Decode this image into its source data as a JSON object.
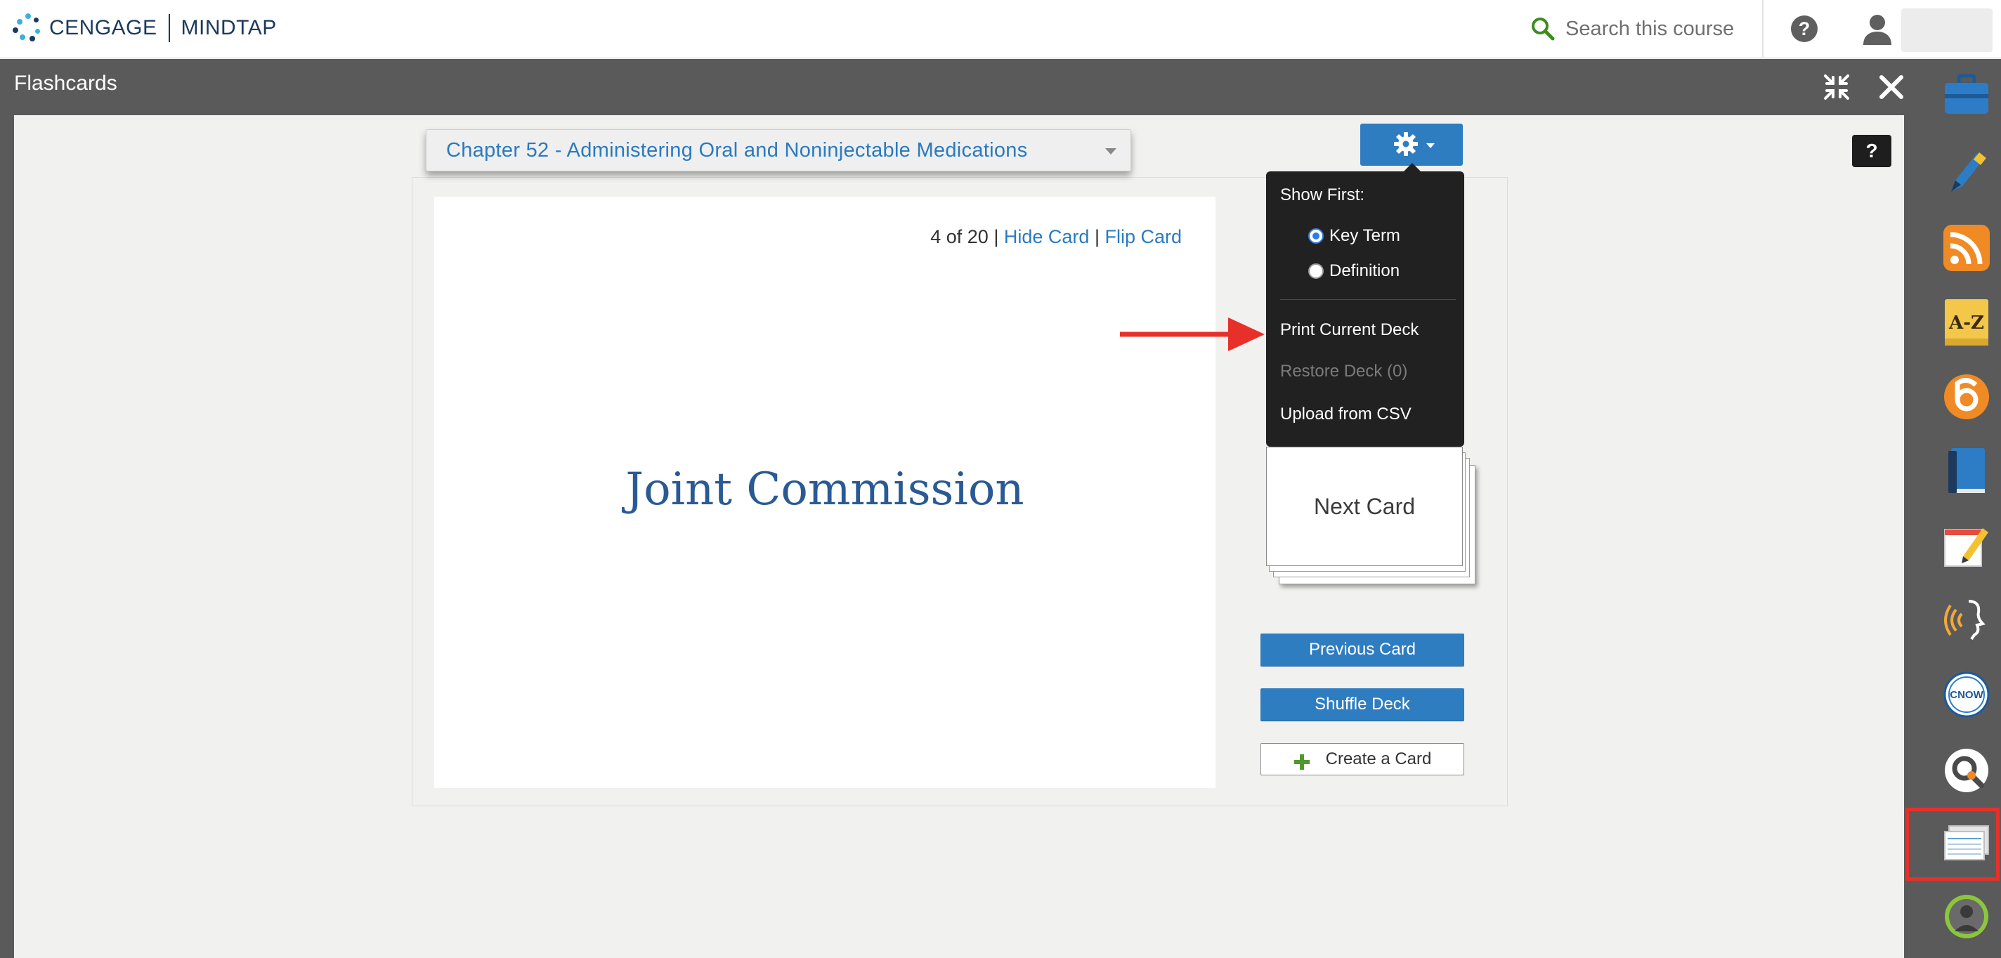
{
  "topbar": {
    "brand_left": "CENGAGE",
    "brand_right": "MINDTAP",
    "search_placeholder": "Search this course",
    "help_label": "?"
  },
  "panel": {
    "title": "Flashcards",
    "help_label": "?"
  },
  "deck": {
    "selected": "Chapter 52 - Administering Oral and Noninjectable Medications"
  },
  "card": {
    "position": "4 of 20",
    "separator": "|",
    "hide_label": "Hide Card",
    "flip_label": "Flip Card",
    "term": "Joint Commission"
  },
  "settings_menu": {
    "heading": "Show First:",
    "options": [
      {
        "label": "Key Term",
        "selected": true
      },
      {
        "label": "Definition",
        "selected": false
      }
    ],
    "print": "Print Current Deck",
    "restore": "Restore Deck (0)",
    "upload": "Upload from CSV"
  },
  "controls": {
    "next": "Next Card",
    "previous": "Previous Card",
    "shuffle": "Shuffle Deck",
    "create": "Create a Card"
  },
  "dock": {
    "items": [
      "briefcase-icon",
      "pencil-highlighter-icon",
      "rss-icon",
      "a-z-glossary-icon",
      "circular-app-icon",
      "book-icon",
      "notepad-icon",
      "readspeaker-icon",
      "cnow-icon",
      "search-magnifier-icon",
      "flashcards-icon",
      "profile-app-icon"
    ],
    "cnow_label": "CNOW",
    "az_label": "A-Z"
  },
  "colors": {
    "accent": "#2f7dc1",
    "link": "#2a7abf",
    "panel_header": "#5a5a5a",
    "highlight": "#e8302a"
  }
}
